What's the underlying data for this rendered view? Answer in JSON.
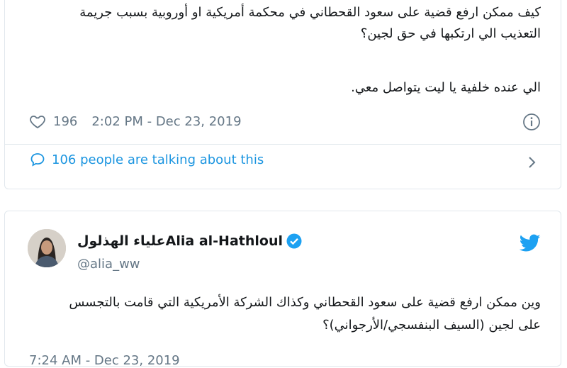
{
  "tweet1": {
    "lines": [
      "كيف ممكن ارفع قضية على سعود القحطاني في محكمة أمريكية او أوروبية بسبب جريمة",
      "التعذيب الي ارتكبها في حق لجين؟",
      "الي عنده خلفية يا ليت يتواصل معي."
    ],
    "likes": "196",
    "timestamp": "2:02 PM - Dec 23, 2019",
    "talking": "106 people are talking about this"
  },
  "tweet2": {
    "display_name_ar": "علياء الهذلول",
    "display_name_en": "Alia al-Hathloul",
    "handle": "@alia_ww",
    "lines": [
      "وين ممكن ارفع قضية على سعود القحطاني وكذاك الشركة الأمريكية التي قامت بالتجسس",
      "على لجين (السيف البنفسجي/الأرجواني)؟"
    ],
    "timestamp_partial": "7:24 AM - Dec 23, 2019"
  },
  "colors": {
    "accent": "#1da1f2",
    "link": "#1b95e0",
    "muted": "#657786",
    "border": "#e1e8ed"
  },
  "icons": [
    "heart-icon",
    "info-icon",
    "reply-bubble-icon",
    "chevron-right-icon",
    "verified-badge-icon",
    "twitter-bird-icon"
  ]
}
